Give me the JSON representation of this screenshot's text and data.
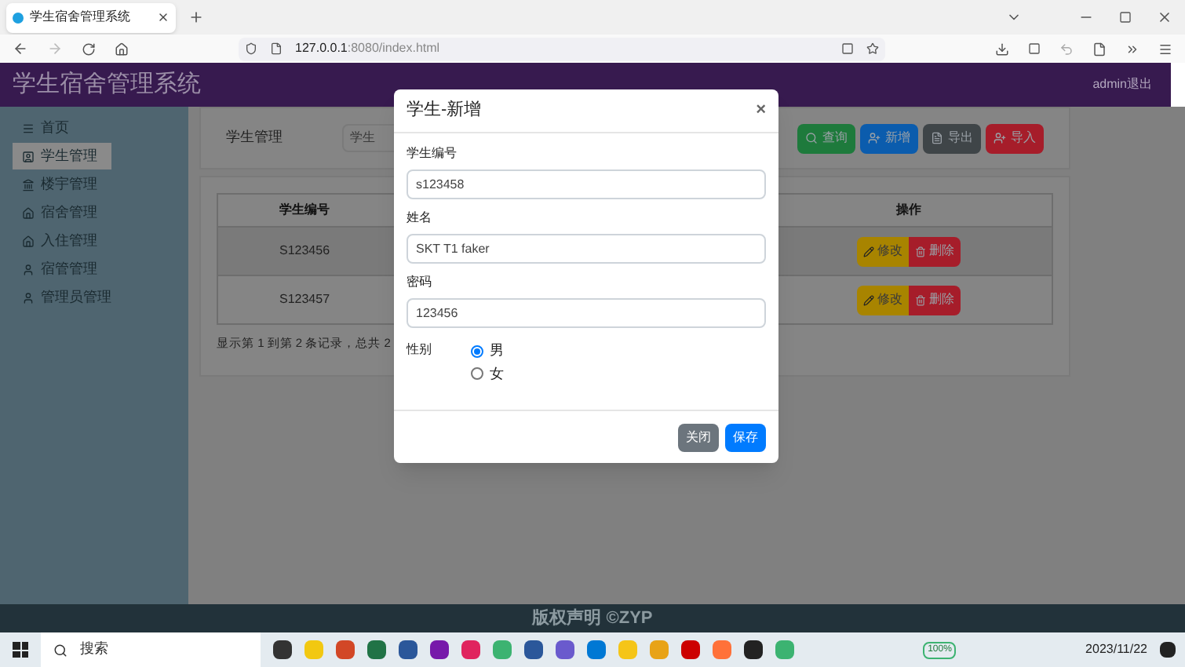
{
  "browser": {
    "tab_title": "学生宿舍管理系统",
    "url_host": "127.0.0.1",
    "url_path": ":8080/index.html"
  },
  "header": {
    "title": "学生宿舍管理系统",
    "user_link": "admin退出"
  },
  "sidebar": {
    "items": [
      {
        "label": "首页",
        "kind": "menu",
        "selected": false
      },
      {
        "label": "学生管理",
        "kind": "card",
        "selected": true
      },
      {
        "label": "楼宇管理",
        "kind": "bank",
        "selected": false
      },
      {
        "label": "宿舍管理",
        "kind": "home",
        "selected": false
      },
      {
        "label": "入住管理",
        "kind": "home",
        "selected": false
      },
      {
        "label": "宿管管理",
        "kind": "user",
        "selected": false
      },
      {
        "label": "管理员管理",
        "kind": "user",
        "selected": false
      }
    ]
  },
  "search_panel": {
    "label": "学生管理",
    "field_value": "学生",
    "buttons": [
      {
        "label": "查询",
        "kind": "search"
      },
      {
        "label": "新增",
        "kind": "add"
      },
      {
        "label": "导出",
        "kind": "export"
      },
      {
        "label": "导入",
        "kind": "import"
      }
    ]
  },
  "table": {
    "columns": [
      "学生编号",
      "操作"
    ],
    "rows": [
      {
        "student_id": "S123456",
        "actions": [
          "修改",
          "删除"
        ]
      },
      {
        "student_id": "S123457",
        "actions": [
          "修改",
          "删除"
        ]
      }
    ],
    "summary": "显示第 1 到第 2 条记录，总共 2"
  },
  "modal": {
    "title": "学生-新增",
    "close": "×",
    "fields": [
      {
        "label": "学生编号",
        "value": "s123458"
      },
      {
        "label": "姓名",
        "value": "SKT T1 faker"
      },
      {
        "label": "密码",
        "value": "123456"
      }
    ],
    "gender": {
      "label": "性别",
      "options": [
        {
          "label": "男",
          "selected": true
        },
        {
          "label": "女",
          "selected": false
        }
      ]
    },
    "buttons": [
      {
        "label": "关闭",
        "kind": "secondary"
      },
      {
        "label": "保存",
        "kind": "primary"
      }
    ]
  },
  "footer": {
    "text": "版权声明 ©ZYP"
  },
  "taskbar": {
    "search_placeholder": "搜索",
    "battery": "100%",
    "date": "2023/11/22"
  }
}
